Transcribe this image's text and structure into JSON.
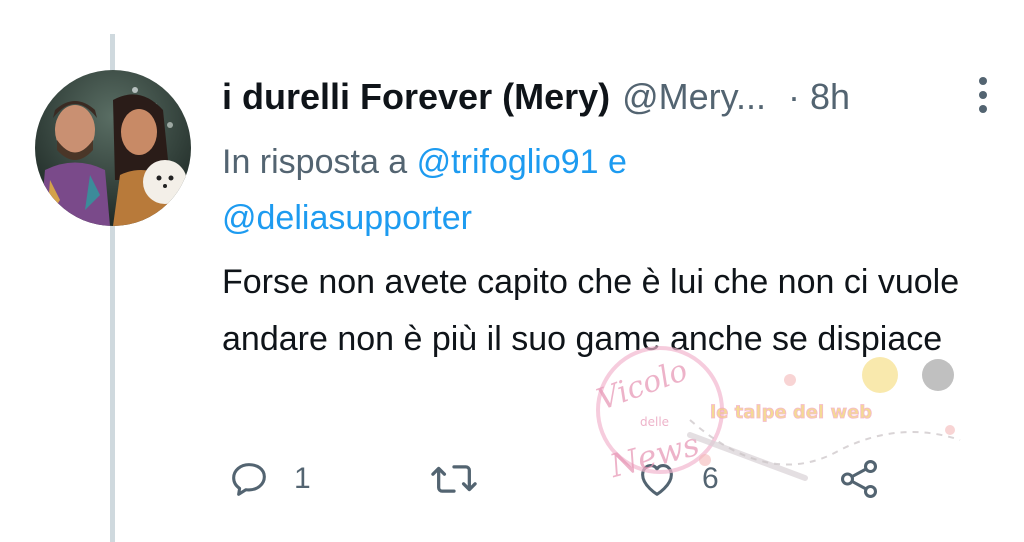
{
  "tweet": {
    "display_name": "i durelli Forever (Mery)",
    "handle": "@Mery...",
    "time": "· 8h",
    "reply_prefix": "In risposta a ",
    "reply_mention_1": "@trifoglio91",
    "reply_connector": " e",
    "reply_mention_2": "@deliasupporter",
    "text": "Forse non avete capito che è lui che non ci vuole andare non è più il suo game anche se dispiace"
  },
  "actions": {
    "reply_count": "1",
    "retweet_count": "",
    "like_count": "6"
  },
  "watermark": {
    "logo_text": "Vicolo delle News",
    "banner_text": "le talpe del web"
  },
  "colors": {
    "text_primary": "#0f1419",
    "text_secondary": "#536471",
    "link": "#1d9bf0",
    "thread_line": "#cfd9de"
  },
  "icons": [
    "reply-icon",
    "retweet-icon",
    "like-icon",
    "share-icon",
    "more-options-icon"
  ]
}
